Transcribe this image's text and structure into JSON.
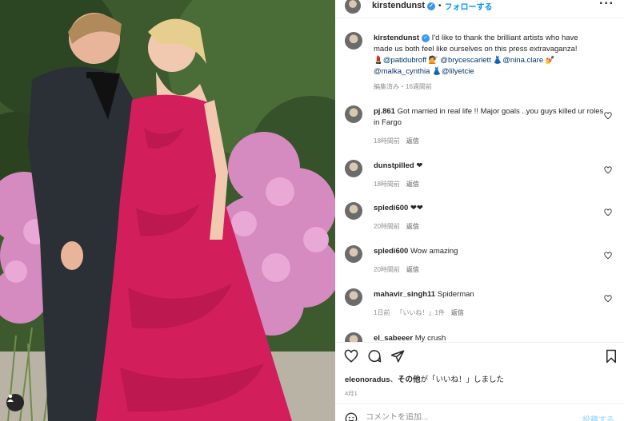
{
  "post": {
    "username": "kirstendunst",
    "follow_label": "フォローする",
    "dot": "•",
    "more": "···",
    "caption_user": "kirstendunst",
    "caption_lines": [
      "I'd like to thank the brilliant artists who have",
      "made us both feel like ourselves on this press extravaganza!",
      "💄@patidubroff 💇 @brycescarlett 👗@nina.clare 💅",
      "@malka_cynthia 👗@lilyetcie"
    ],
    "caption_meta": "編集済み・16週間前"
  },
  "comments": [
    {
      "user": "pj.861",
      "text": "Got married in real life !! Major goals ..you guys killed ur roles in Fargo",
      "time": "18時間前",
      "reply": "返信"
    },
    {
      "user": "dunstpilled",
      "text": "❤",
      "time": "18時間前",
      "reply": "返信"
    },
    {
      "user": "spledi600",
      "text": "❤❤",
      "time": "20時間前",
      "reply": "返信"
    },
    {
      "user": "spledi600",
      "text": "Wow amazing",
      "time": "20時間前",
      "reply": "返信"
    },
    {
      "user": "mahavir_singh11",
      "text": "Spiderman",
      "time": "1日前",
      "likes": "「いいね！」1件",
      "reply": "返信"
    },
    {
      "user": "el_sabeeer",
      "text": "My crush"
    }
  ],
  "likes_line": {
    "user": "eleonoradus",
    "sep": "、",
    "others": "その他",
    "rest": "が「いいね！」しました"
  },
  "date": "4月1",
  "comment_input": {
    "placeholder": "コメントを追加...",
    "post_label": "投稿する"
  },
  "icons": [
    "heart-icon",
    "comment-icon",
    "share-icon",
    "bookmark-icon",
    "more-icon",
    "verified-icon",
    "user-tag-icon",
    "emoji-icon"
  ],
  "colors": {
    "accent": "#0095f6",
    "verified": "#3897f0",
    "muted": "#8e8e8e"
  }
}
